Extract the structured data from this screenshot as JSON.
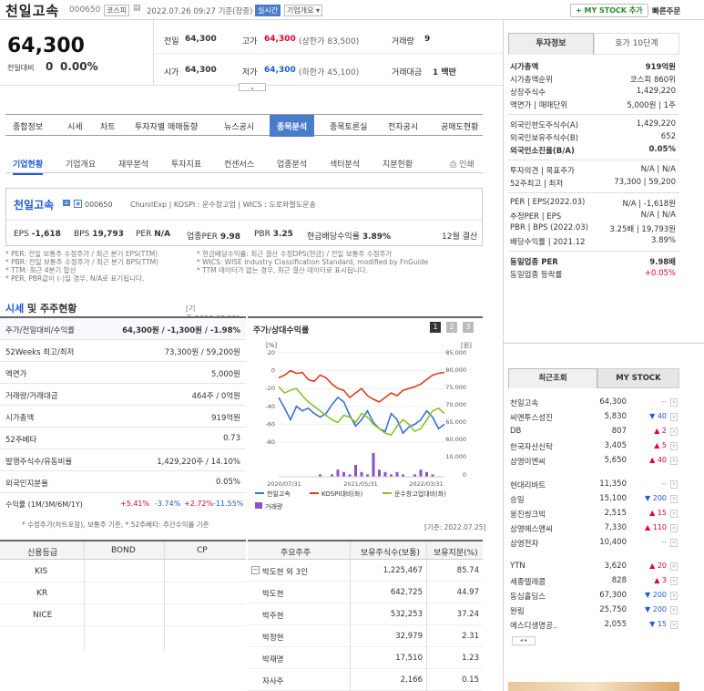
{
  "header": {
    "name": "천일고속",
    "code": "000650",
    "market": "코스피",
    "datetime": "2022.07.26 09:27 기준(장중)",
    "realtime": "실시간",
    "company_summary": "기업개요",
    "add_btn": "+ MY STOCK 추가",
    "fast_order": "빠른주문"
  },
  "price": {
    "current": "64,300",
    "change_label": "전일대비",
    "change": "0",
    "pct": "0.00%"
  },
  "quote": {
    "prev_label": "전일",
    "prev": "64,300",
    "high_label": "고가",
    "high": "64,300",
    "high_note": "(상한가 83,500)",
    "vol_label": "거래량",
    "vol": "9",
    "open_label": "시가",
    "open": "64,300",
    "low_label": "저가",
    "low": "64,300",
    "low_note": "(하한가 45,100)",
    "amt_label": "거래대금",
    "amt": "1 백만"
  },
  "nav": {
    "items": [
      "종합정보",
      "시세",
      "차트",
      "투자자별 매매동향",
      "뉴스공시",
      "종목분석",
      "종목토론실",
      "전자공시",
      "공매도현황"
    ]
  },
  "subnav": {
    "items": [
      "기업현황",
      "기업개요",
      "재무분석",
      "투자지표",
      "컨센서스",
      "업종분석",
      "섹터분석",
      "지분현황"
    ],
    "print": "인쇄"
  },
  "card": {
    "name": "천일고속",
    "code": "000650",
    "meta": "ChunilExp  |  KOSPI : 운수창고업  |  WICS : 도로와철도운송",
    "eps_l": "EPS",
    "eps": "-1,618",
    "bps_l": "BPS",
    "bps": "19,793",
    "per_l": "PER",
    "per": "N/A",
    "iper_l": "업종PER",
    "iper": "9.98",
    "pbr_l": "PBR",
    "pbr": "3.25",
    "div_l": "현금배당수익률",
    "div": "3.89%",
    "fy": "12월 결산"
  },
  "notes": {
    "n1": "* PER: 전일 보통주 수정주가 / 최근 분기 EPS(TTM)",
    "n2": "* PBR: 전일 보통주 수정주가 / 최근 분기 BPS(TTM)",
    "n3": "* TTM: 최근 4분기 합산",
    "n4": "* PER, PBR값이 (-)일 경우, N/A로 표기됩니다.",
    "n5": "* 현금배당수익률: 최근 결산 수정DPS(현금) / 전일 보통주 수정주가",
    "n6": "* WICS: WISE Industry Classification Standard, modified by FnGuide",
    "n7": "* TTM 데이터가 없는 경우, 최근 결산 데이터로 표시됩니다."
  },
  "price_table": {
    "title": "시세",
    "title2": "및 주주현황",
    "date": "[기준:2022.07.25]",
    "rows": [
      {
        "l": "주가/전일대비/수익률",
        "v": "64,300원 / -1,300원 / -1.98%"
      },
      {
        "l": "52Weeks 최고/최저",
        "v": "73,300원 / 59,200원"
      },
      {
        "l": "액면가",
        "v": "5,000원"
      },
      {
        "l": "거래량/거래대금",
        "v": "464주 / 0억원"
      },
      {
        "l": "시가총액",
        "v": "919억원"
      },
      {
        "l": "52주베타",
        "v": "0.73"
      },
      {
        "l": "발행주식수/유동비율",
        "v": "1,429,220주 / 14.10%"
      },
      {
        "l": "외국인지분율",
        "v": "0.05%"
      }
    ],
    "ret_label": "수익률 (1M/3M/6M/1Y)",
    "ret1": "+5.41%",
    "ret2": "-3.74%",
    "ret3": "+2.72%",
    "ret4": "-11.55%",
    "footnote": "* 수정주가(차트포함), 보통주 기준, * 52주베타: 주간수익률 기준"
  },
  "chart_data": {
    "type": "line",
    "title": "주가/상대수익률",
    "tabs": [
      "1",
      "2",
      "3"
    ],
    "x_ticks": [
      "2020/07/31",
      "2021/05/31",
      "2022/03/31"
    ],
    "y_left_unit": "[%]",
    "y_right_unit": "[원]",
    "y_left": [
      20,
      0,
      -20,
      -40,
      -60,
      -80
    ],
    "y_right": [
      "85,000",
      "80,000",
      "75,000",
      "70,000",
      "65,000",
      "60,000",
      "10,000",
      "0"
    ],
    "ylim_left": [
      -80,
      20
    ],
    "ylim_right": [
      60000,
      85000
    ],
    "series": [
      {
        "name": "천일고속",
        "color": "#3a6fd8",
        "values": [
          -30,
          -42,
          -55,
          -40,
          -45,
          -42,
          -48,
          -52,
          -48,
          -38,
          -30,
          -35,
          -50,
          -62,
          -55,
          -45,
          -58,
          -65,
          -68,
          -48,
          -55,
          -70,
          -63,
          -60,
          -55,
          -45,
          -52,
          -65,
          -60
        ]
      },
      {
        "name": "KOSPI대비(좌)",
        "color": "#d9401f",
        "values": [
          -8,
          -5,
          0,
          -3,
          -2,
          -10,
          -12,
          -5,
          -8,
          -15,
          -20,
          -22,
          -30,
          -25,
          -20,
          -28,
          -32,
          -35,
          -30,
          -25,
          -28,
          -22,
          -20,
          -18,
          -15,
          -10,
          -5,
          -3,
          -2
        ]
      },
      {
        "name": "운수창고업대비(좌)",
        "color": "#8ac22a",
        "values": [
          -18,
          -25,
          -22,
          -20,
          -28,
          -35,
          -40,
          -45,
          -50,
          -55,
          -58,
          -50,
          -52,
          -58,
          -48,
          -52,
          -60,
          -65,
          -70,
          -72,
          -62,
          -55,
          -60,
          -68,
          -65,
          -55,
          -45,
          -42,
          -48
        ]
      }
    ],
    "volume": {
      "name": "거래량",
      "color": "#8a52c4",
      "values": [
        0,
        0,
        0,
        0,
        0,
        0,
        0,
        1,
        0,
        1,
        3,
        2,
        1,
        5,
        2,
        1,
        10,
        3,
        2,
        1,
        2,
        1,
        0,
        1,
        3,
        2,
        1,
        0,
        0
      ]
    }
  },
  "rating": {
    "headers": [
      "신용등급",
      "BOND",
      "CP"
    ],
    "rows": [
      "KIS",
      "KR",
      "NICE"
    ]
  },
  "holders": {
    "date": "[기준: 2022.07.25]",
    "headers": [
      "주요주주",
      "보유주식수(보통)",
      "보유지분(%)"
    ],
    "rows": [
      {
        "n": "박도현 외 3인",
        "s": "1,225,467",
        "p": "85.74"
      },
      {
        "n": "박도현",
        "s": "642,725",
        "p": "44.97"
      },
      {
        "n": "박주현",
        "s": "532,253",
        "p": "37.24"
      },
      {
        "n": "박정현",
        "s": "32,979",
        "p": "2.31"
      },
      {
        "n": "박재명",
        "s": "17,510",
        "p": "1.23"
      },
      {
        "n": "자사주",
        "s": "2,166",
        "p": "0.15"
      }
    ]
  },
  "invest": {
    "tab1": "투자정보",
    "tab2": "호가 10단계",
    "rows": [
      {
        "l": "시가총액",
        "v": "919억원",
        "b": true
      },
      {
        "l": "시가총액순위",
        "v": "코스피 860위"
      },
      {
        "l": "상장주식수",
        "v": "1,429,220"
      },
      {
        "l": "액면가 | 매매단위",
        "v": "5,000원 | 1주"
      },
      {
        "l": "외국인한도주식수(A)",
        "v": "1,429,220"
      },
      {
        "l": "외국인보유주식수(B)",
        "v": "652"
      },
      {
        "l": "외국인소진율(B/A)",
        "v": "0.05%",
        "b": true
      },
      {
        "l": "투자의견 | 목표주가",
        "v": "N/A | N/A"
      },
      {
        "l": "52주최고 | 최저",
        "v": "73,300 | 59,200"
      },
      {
        "l": "PER | EPS(2022.03)",
        "v": "N/A | -1,618원"
      },
      {
        "l": "추정PER | EPS",
        "v": "N/A | N/A"
      },
      {
        "l": "PBR | BPS (2022.03)",
        "v": "3.25배 | 19,793원"
      },
      {
        "l": "배당수익률 | 2021.12",
        "v": "3.89%"
      },
      {
        "l": "동일업종 PER",
        "v": "9.98배",
        "b": true
      },
      {
        "l": "동일업종 등락률",
        "v": "+0.05%",
        "red": true
      }
    ]
  },
  "recent": {
    "tab1": "최근조회",
    "tab2": "MY STOCK",
    "rows": [
      {
        "n": "천일고속",
        "p": "64,300",
        "c": "--",
        "d": "n"
      },
      {
        "n": "씨앤투스성진",
        "p": "5,830",
        "c": "▼ 40",
        "d": "d"
      },
      {
        "n": "DB",
        "p": "807",
        "c": "▲ 2",
        "d": "u"
      },
      {
        "n": "한국자산신탁",
        "p": "3,405",
        "c": "▲ 5",
        "d": "u"
      },
      {
        "n": "삼영이엔씨",
        "p": "5,650",
        "c": "▲ 40",
        "d": "u"
      },
      {
        "n": "현대리바트",
        "p": "11,350",
        "c": "--",
        "d": "n"
      },
      {
        "n": "승일",
        "p": "15,100",
        "c": "▼ 200",
        "d": "d"
      },
      {
        "n": "웅진씽크빅",
        "p": "2,515",
        "c": "▲ 15",
        "d": "u"
      },
      {
        "n": "삼영에스앤씨",
        "p": "7,330",
        "c": "▲ 110",
        "d": "u"
      },
      {
        "n": "삼영전자",
        "p": "10,400",
        "c": "--",
        "d": "n"
      },
      {
        "n": "YTN",
        "p": "3,620",
        "c": "▲ 20",
        "d": "u"
      },
      {
        "n": "세종텔레콤",
        "p": "828",
        "c": "▲ 3",
        "d": "u"
      },
      {
        "n": "동심홀딩스",
        "p": "67,300",
        "c": "▼ 200",
        "d": "d"
      },
      {
        "n": "원림",
        "p": "25,750",
        "c": "▼ 200",
        "d": "d"
      },
      {
        "n": "에스디생명공..",
        "p": "2,055",
        "c": "▼ 15",
        "d": "d"
      }
    ]
  }
}
